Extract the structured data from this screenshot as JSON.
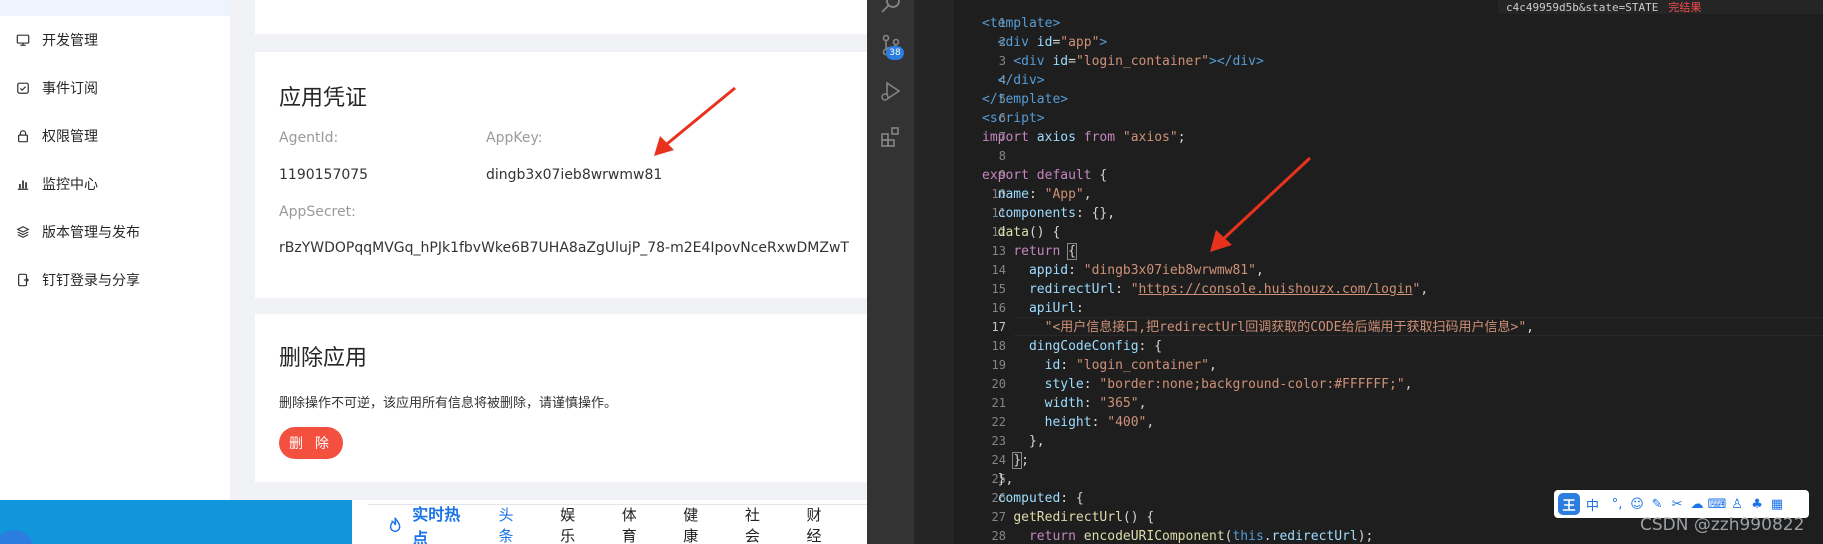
{
  "sidebar": {
    "items": [
      {
        "label": "开发管理",
        "icon": "monitor-icon"
      },
      {
        "label": "事件订阅",
        "icon": "calendar-check-icon"
      },
      {
        "label": "权限管理",
        "icon": "lock-icon"
      },
      {
        "label": "监控中心",
        "icon": "bar-chart-icon"
      },
      {
        "label": "版本管理与发布",
        "icon": "layers-icon"
      },
      {
        "label": "钉钉登录与分享",
        "icon": "share-phone-icon"
      }
    ]
  },
  "credentials": {
    "title": "应用凭证",
    "agentid_label": "AgentId:",
    "agentid_value": "1190157075",
    "appkey_label": "AppKey:",
    "appkey_value": "dingb3x07ieb8wrwmw81",
    "appsecret_label": "AppSecret:",
    "appsecret_value": "rBzYWDOPqqMVGq_hPJk1fbvWke6B7UHA8aZgUlujP_78-m2E4IpovNceRxwDMZwT"
  },
  "delete_app": {
    "title": "删除应用",
    "warning": "删除操作不可逆，该应用所有信息将被删除，请谨慎操作。",
    "button_label": "删 除"
  },
  "news": {
    "hot_label": "实时热点",
    "tabs": [
      "头条",
      "娱乐",
      "体育",
      "健康",
      "社会",
      "财经"
    ]
  },
  "editor": {
    "badge_count": "38",
    "top_bar_text": "c4c49959d5b&state=STATE",
    "top_bar_red": "完结果",
    "line_numbers": [
      "1",
      "2",
      "3",
      "4",
      "5",
      "6",
      "7",
      "8",
      "9",
      "10",
      "11",
      "12",
      "13",
      "14",
      "15",
      "16",
      "17",
      "18",
      "19",
      "20",
      "21",
      "22",
      "23",
      "24",
      "25",
      "26",
      "27",
      "28"
    ],
    "active_line": "17"
  },
  "ime": {
    "logo": "王",
    "mode": "中"
  },
  "watermark": "CSDN @zzh990822",
  "colors": {
    "accent_red": "#f4503f",
    "editor_bg": "#1e1e1e",
    "arrow_red": "#e8321e"
  }
}
